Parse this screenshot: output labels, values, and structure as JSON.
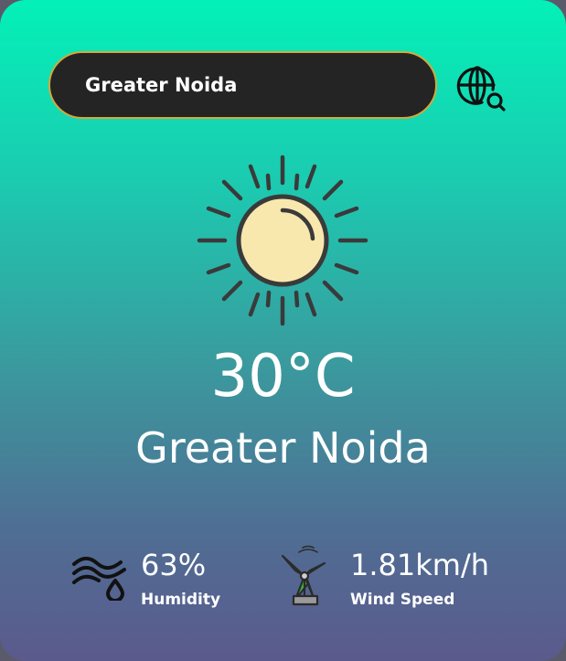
{
  "search": {
    "value": "Greater Noida",
    "button_icon": "globe-search-icon"
  },
  "weather": {
    "icon": "sun-icon",
    "temperature": "30°C",
    "city": "Greater Noida"
  },
  "details": {
    "humidity": {
      "icon": "humidity-icon",
      "value": "63%",
      "label": "Humidity"
    },
    "wind": {
      "icon": "wind-turbine-icon",
      "value": "1.81km/h",
      "label": "Wind Speed"
    }
  },
  "colors": {
    "gradient_top": "#03f1b8",
    "gradient_bottom": "#5b5a8c",
    "search_bg": "#242424",
    "search_border": "#d3a93c",
    "sun_fill": "#f8e8ae",
    "icon_stroke": "#3a3a3a",
    "turbine_green": "#3fb34a"
  }
}
